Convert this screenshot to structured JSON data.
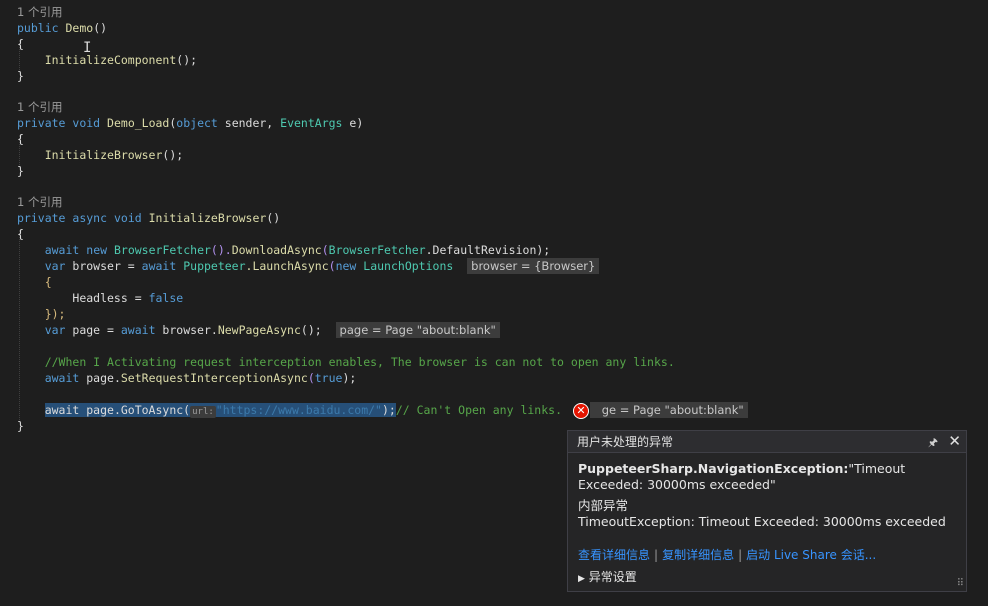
{
  "code": {
    "ref1": "1 个引用",
    "ref2": "1 个引用",
    "ref3": "1 个引用",
    "l_pub_kw": "public",
    "l_pub_fn": "Demo",
    "l_pub_rest": "()",
    "open1": "{",
    "init_comp": "InitializeComponent",
    "init_comp_rest": "();",
    "close1": "}",
    "priv_kw": "private",
    "void_kw": "void",
    "demo_load": "Demo_Load",
    "paren_open": "(",
    "object_kw": "object",
    "sender": " sender, ",
    "eventargs": "EventArgs",
    "e_rest": " e)",
    "open2": "{",
    "init_browser_call": "InitializeBrowser",
    "init_browser_rest": "();",
    "close2": "}",
    "priv_kw2": "private",
    "async_kw": "async",
    "void_kw2": "void",
    "init_browser_decl": "InitializeBrowser",
    "init_browser_decl_rest": "()",
    "open3": "{",
    "l1_await": "await",
    "l1_new": "new",
    "l1_type": "BrowserFetcher",
    "l1_mid": "().",
    "l1_fn": "DownloadAsync",
    "l1_open": "(",
    "l1_type2": "BrowserFetcher",
    "l1_prop": ".DefaultRevision",
    "l1_close": ");",
    "l2_var": "var",
    "l2_name": " browser = ",
    "l2_await": "await",
    "l2_type": "Puppeteer",
    "l2_fn": ".LaunchAsync",
    "l2_open": "(",
    "l2_new": "new",
    "l2_type2": "LaunchOptions",
    "l2_tip": "browser = {Browser}",
    "l3": "{",
    "l4_prop": "Headless = ",
    "l4_false": "false",
    "l5": "});",
    "l6_var": "var",
    "l6_name": " page = ",
    "l6_await": "await",
    "l6_obj": " browser.",
    "l6_fn": "NewPageAsync",
    "l6_rest": "();",
    "l6_tip": "page = Page \"about:blank\"",
    "comment1": "//When I Activating request interception enables, The browser is can not to open any links.",
    "l8_await": "await",
    "l8_obj": " page.",
    "l8_fn": "SetRequestInterceptionAsync",
    "l8_open": "(",
    "l8_true": "true",
    "l8_close": ");",
    "l9_code": "await page.GoToAsync(",
    "l9_hint": "url:",
    "l9_str": "\"https://www.baidu.com/\"",
    "l9_close": ");",
    "l9_comment": "// Can't Open any links.",
    "l9_tip": "ge = Page \"about:blank\"",
    "close3": "}"
  },
  "exception_popup": {
    "title": "用户未处理的异常",
    "exception_type": "PuppeteerSharp.NavigationException:",
    "message": "\"Timeout Exceeded: 30000ms exceeded\"",
    "inner_title": "内部异常",
    "inner_message": "TimeoutException: Timeout Exceeded: 30000ms exceeded",
    "link_details": "查看详细信息",
    "link_copy": "复制详细信息",
    "link_liveshare": "启动 Live Share 会话...",
    "settings": "异常设置"
  },
  "icons": {
    "error": "error-circle-icon",
    "pin": "pin-icon",
    "close": "close-icon",
    "expand": "triangle-right-icon",
    "resize": "resize-grip-icon"
  },
  "colors": {
    "background": "#1e1e1e",
    "keyword": "#569cd6",
    "type": "#4ec9b0",
    "method": "#dcdcaa",
    "comment": "#57a64a",
    "link": "#3794ff",
    "error": "#e51400"
  }
}
